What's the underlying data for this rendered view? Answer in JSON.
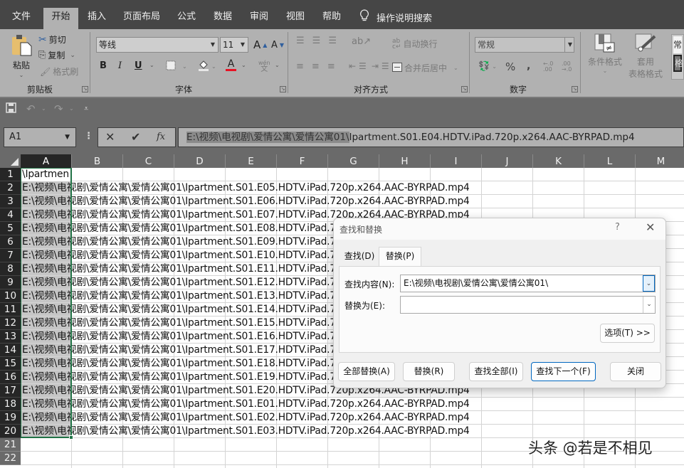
{
  "menu": {
    "tabs": [
      {
        "label": "文件",
        "active": false
      },
      {
        "label": "开始",
        "active": true
      },
      {
        "label": "插入",
        "active": false
      },
      {
        "label": "页面布局",
        "active": false
      },
      {
        "label": "公式",
        "active": false
      },
      {
        "label": "数据",
        "active": false
      },
      {
        "label": "审阅",
        "active": false
      },
      {
        "label": "视图",
        "active": false
      },
      {
        "label": "帮助",
        "active": false
      }
    ],
    "tell_me": "操作说明搜索"
  },
  "ribbon": {
    "clipboard": {
      "paste": "粘贴",
      "cut": "剪切",
      "copy": "复制",
      "format_painter": "格式刷",
      "group_label": "剪贴板"
    },
    "font": {
      "font_name": "等线",
      "font_size": "11",
      "bold": "B",
      "italic": "I",
      "underline": "U",
      "phonetic": "wén",
      "phonetic_char": "文",
      "grow": "A",
      "shrink": "A",
      "font_color": "A",
      "font_color_hex": "#e81123",
      "group_label": "字体"
    },
    "alignment": {
      "wrap_text": "自动换行",
      "merge_center": "合并后居中",
      "group_label": "对齐方式"
    },
    "number": {
      "format": "常规",
      "percent": "%",
      "comma": ",",
      "inc_decimal": "←.0 .00",
      "dec_decimal": ".00 →.0",
      "group_label": "数字"
    },
    "styles": {
      "conditional_format": "条件格式",
      "table_format_line1": "套用",
      "table_format_line2": "表格格式",
      "style_preview_1": "常",
      "style_preview_2": "格"
    }
  },
  "formula_bar": {
    "name_box": "A1",
    "fx": "fx",
    "value_selected_part": "E:\\视频\\电视剧\\爱情公寓\\爱情公寓01\\",
    "value_rest": "Ipartment.S01.E04.HDTV.iPad.720p.x264.AAC-BYRPAD.mp4"
  },
  "grid": {
    "columns": [
      "A",
      "B",
      "C",
      "D",
      "E",
      "F",
      "G",
      "H",
      "I",
      "J",
      "K",
      "L",
      "M"
    ],
    "selected_column": "A",
    "rows": [
      {
        "n": "1",
        "a": "\\Ipartmen"
      },
      {
        "n": "2",
        "a": "E:\\视频\\电视剧\\爱情公寓\\爱情公寓01\\Ipartment.S01.E05.HDTV.iPad.720p.x264.AAC-BYRPAD.mp4"
      },
      {
        "n": "3",
        "a": "E:\\视频\\电视剧\\爱情公寓\\爱情公寓01\\Ipartment.S01.E06.HDTV.iPad.720p.x264.AAC-BYRPAD.mp4"
      },
      {
        "n": "4",
        "a": "E:\\视频\\电视剧\\爱情公寓\\爱情公寓01\\Ipartment.S01.E07.HDTV.iPad.720p.x264.AAC-BYRPAD.mp4"
      },
      {
        "n": "5",
        "a": "E:\\视频\\电视剧\\爱情公寓\\爱情公寓01\\Ipartment.S01.E08.HDTV.iPad.720p.x264.AAC-BYRPAD.mp4"
      },
      {
        "n": "6",
        "a": "E:\\视频\\电视剧\\爱情公寓\\爱情公寓01\\Ipartment.S01.E09.HDTV.iPad.720p.x264.AAC-BYRPAD.mp4"
      },
      {
        "n": "7",
        "a": "E:\\视频\\电视剧\\爱情公寓\\爱情公寓01\\Ipartment.S01.E10.HDTV.iPad.720p.x264.AAC-BYRPAD.mp4"
      },
      {
        "n": "8",
        "a": "E:\\视频\\电视剧\\爱情公寓\\爱情公寓01\\Ipartment.S01.E11.HDTV.iPad.720p.x264.AAC-BYRPAD.mp4"
      },
      {
        "n": "9",
        "a": "E:\\视频\\电视剧\\爱情公寓\\爱情公寓01\\Ipartment.S01.E12.HDTV.iPad.720p.x264.AAC-BYRPAD.mp4"
      },
      {
        "n": "10",
        "a": "E:\\视频\\电视剧\\爱情公寓\\爱情公寓01\\Ipartment.S01.E13.HDTV.iPad.720p.x264.AAC-BYRPAD.mp4"
      },
      {
        "n": "11",
        "a": "E:\\视频\\电视剧\\爱情公寓\\爱情公寓01\\Ipartment.S01.E14.HDTV.iPad.720p.x264.AAC-BYRPAD.mp4"
      },
      {
        "n": "12",
        "a": "E:\\视频\\电视剧\\爱情公寓\\爱情公寓01\\Ipartment.S01.E15.HDTV.iPad.720p.x264.AAC-BYRPAD.mp4"
      },
      {
        "n": "13",
        "a": "E:\\视频\\电视剧\\爱情公寓\\爱情公寓01\\Ipartment.S01.E16.HDTV.iPad.720p.x264.AAC-BYRPAD.mp4"
      },
      {
        "n": "14",
        "a": "E:\\视频\\电视剧\\爱情公寓\\爱情公寓01\\Ipartment.S01.E17.HDTV.iPad.720p.x264.AAC-BYRPAD.mp4"
      },
      {
        "n": "15",
        "a": "E:\\视频\\电视剧\\爱情公寓\\爱情公寓01\\Ipartment.S01.E18.HDTV.iPad.720p.x264.AAC-BYRPAD.mp4"
      },
      {
        "n": "16",
        "a": "E:\\视频\\电视剧\\爱情公寓\\爱情公寓01\\Ipartment.S01.E19.HDTV.iPad.720p.x264.AAC-BYRPAD.mp4"
      },
      {
        "n": "17",
        "a": "E:\\视频\\电视剧\\爱情公寓\\爱情公寓01\\Ipartment.S01.E20.HDTV.iPad.720p.x264.AAC-BYRPAD.mp4"
      },
      {
        "n": "18",
        "a": "E:\\视频\\电视剧\\爱情公寓\\爱情公寓01\\Ipartment.S01.E01.HDTV.iPad.720p.x264.AAC-BYRPAD.mp4"
      },
      {
        "n": "19",
        "a": "E:\\视频\\电视剧\\爱情公寓\\爱情公寓01\\Ipartment.S01.E02.HDTV.iPad.720p.x264.AAC-BYRPAD.mp4"
      },
      {
        "n": "20",
        "a": "E:\\视频\\电视剧\\爱情公寓\\爱情公寓01\\Ipartment.S01.E03.HDTV.iPad.720p.x264.AAC-BYRPAD.mp4"
      },
      {
        "n": "21",
        "a": ""
      },
      {
        "n": "22",
        "a": ""
      }
    ]
  },
  "dialog": {
    "title": "查找和替换",
    "help": "?",
    "tabs": [
      {
        "label": "查找(D)",
        "active": false
      },
      {
        "label": "替换(P)",
        "active": true
      }
    ],
    "find_label": "查找内容(N):",
    "find_value": "E:\\视频\\电视剧\\爱情公寓\\爱情公寓01\\",
    "replace_label": "替换为(E):",
    "replace_value": "",
    "options_button": "选项(T) >>",
    "buttons": {
      "replace_all": "全部替换(A)",
      "replace": "替换(R)",
      "find_all": "查找全部(I)",
      "find_next": "查找下一个(F)",
      "close": "关闭"
    }
  },
  "watermark": "头条 @若是不相见"
}
